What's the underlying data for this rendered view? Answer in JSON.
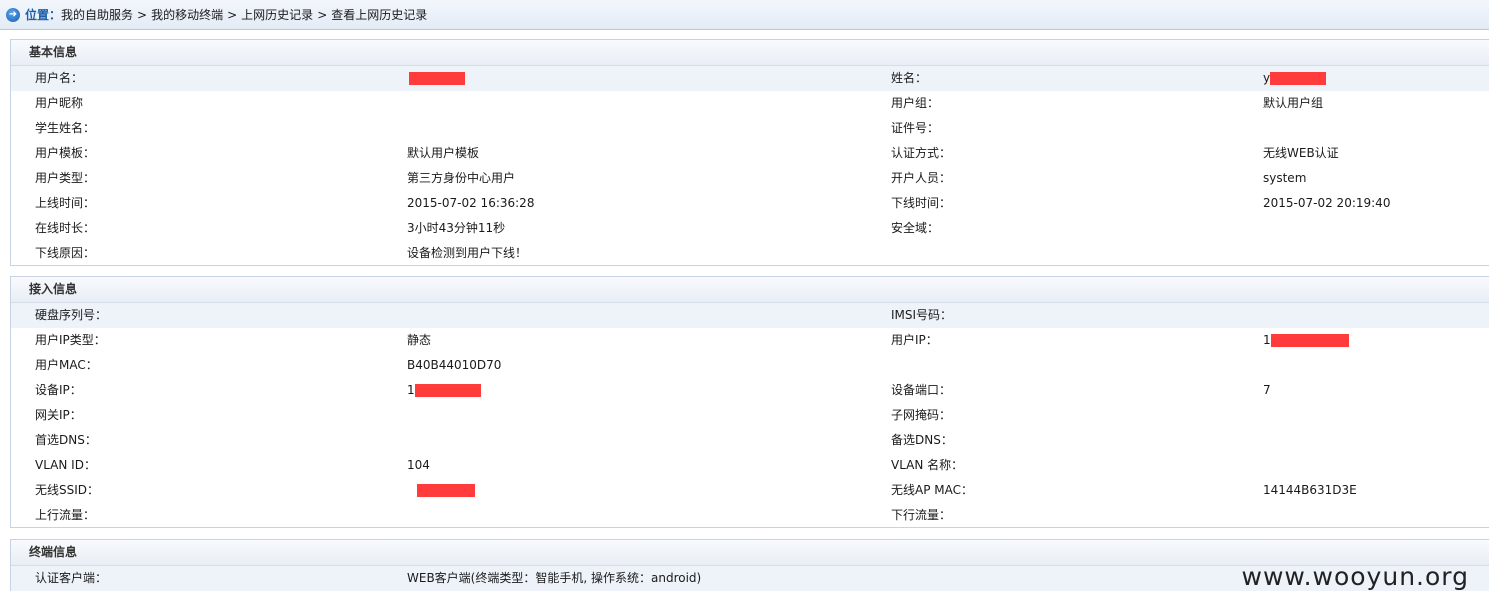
{
  "breadcrumb": {
    "label": "位置：",
    "items": [
      "我的自助服务",
      "我的移动终端",
      "上网历史记录",
      "查看上网历史记录"
    ],
    "separator": ">"
  },
  "basic": {
    "title": "基本信息",
    "rows": [
      [
        "用户名：",
        "",
        "姓名：",
        "y"
      ],
      [
        "用户昵称",
        "",
        "用户组：",
        "默认用户组"
      ],
      [
        "学生姓名：",
        "",
        "证件号：",
        ""
      ],
      [
        "用户模板：",
        "默认用户模板",
        "认证方式：",
        "无线WEB认证"
      ],
      [
        "用户类型：",
        "第三方身份中心用户",
        "开户人员：",
        "system"
      ],
      [
        "上线时间：",
        "2015-07-02 16:36:28",
        "下线时间：",
        "2015-07-02 20:19:40"
      ],
      [
        "在线时长：",
        "3小时43分钟11秒",
        "安全域：",
        ""
      ],
      [
        "下线原因：",
        "设备检测到用户下线！",
        "",
        ""
      ]
    ]
  },
  "access": {
    "title": "接入信息",
    "rows": [
      [
        "硬盘序列号：",
        "",
        "IMSI号码：",
        ""
      ],
      [
        "用户IP类型：",
        "静态",
        "用户IP：",
        "1"
      ],
      [
        "用户MAC：",
        "B40B44010D70",
        "",
        ""
      ],
      [
        "设备IP：",
        "1",
        "设备端口：",
        "7"
      ],
      [
        "网关IP：",
        "",
        "子网掩码：",
        ""
      ],
      [
        "首选DNS：",
        "",
        "备选DNS：",
        ""
      ],
      [
        "VLAN ID：",
        "104",
        "VLAN 名称：",
        ""
      ],
      [
        "无线SSID：",
        "",
        "无线AP MAC：",
        "14144B631D3E"
      ],
      [
        "上行流量：",
        "",
        "下行流量：",
        ""
      ]
    ]
  },
  "terminal": {
    "title": "终端信息",
    "rows": [
      [
        "认证客户端：",
        "WEB客户端(终端类型：智能手机, 操作系统：android)",
        "",
        ""
      ]
    ]
  },
  "watermark": "www.wooyun.org",
  "colors": {
    "accent": "#1f5fa8",
    "redaction": "#ff3b3b",
    "row_highlight": "#eef3fa"
  },
  "icons": {
    "location": "arrow-circle-icon"
  }
}
